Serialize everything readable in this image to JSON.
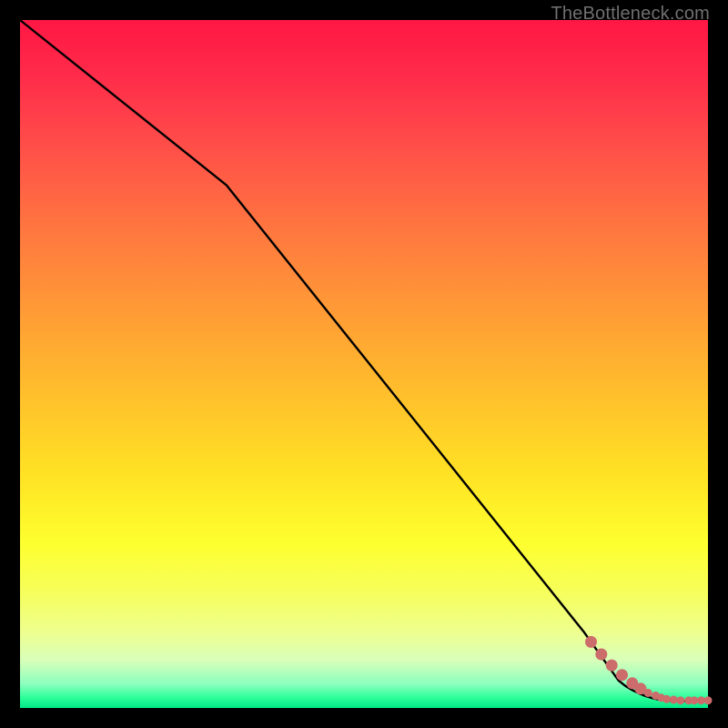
{
  "watermark": "TheBottleneck.com",
  "chart_data": {
    "type": "line",
    "title": "",
    "xlabel": "",
    "ylabel": "",
    "xlim": [
      0,
      100
    ],
    "ylim": [
      0,
      100
    ],
    "series": [
      {
        "name": "curve",
        "x": [
          0,
          30,
          82,
          87,
          88,
          89,
          90,
          91,
          92,
          93,
          94,
          95,
          96,
          97,
          98,
          99,
          100
        ],
        "y": [
          100,
          76,
          11,
          4.0,
          3.2,
          2.6,
          2.1,
          1.7,
          1.4,
          1.2,
          1.1,
          1.0,
          1.0,
          1.0,
          1.0,
          1.0,
          1.0
        ]
      }
    ],
    "markers": {
      "name": "tail-points",
      "x": [
        83.0,
        84.5,
        86.0,
        87.5,
        89.0,
        90.2,
        91.3,
        92.4,
        93.2,
        94.0,
        95.0,
        96.0,
        97.2,
        98.0,
        99.0,
        100.0
      ],
      "y": [
        9.6,
        7.8,
        6.2,
        4.8,
        3.6,
        2.8,
        2.2,
        1.8,
        1.5,
        1.3,
        1.2,
        1.1,
        1.1,
        1.1,
        1.1,
        1.1
      ],
      "color": "#cc6d6b"
    },
    "colors": {
      "curve": "#000000",
      "marker": "#cc6d6b"
    }
  }
}
